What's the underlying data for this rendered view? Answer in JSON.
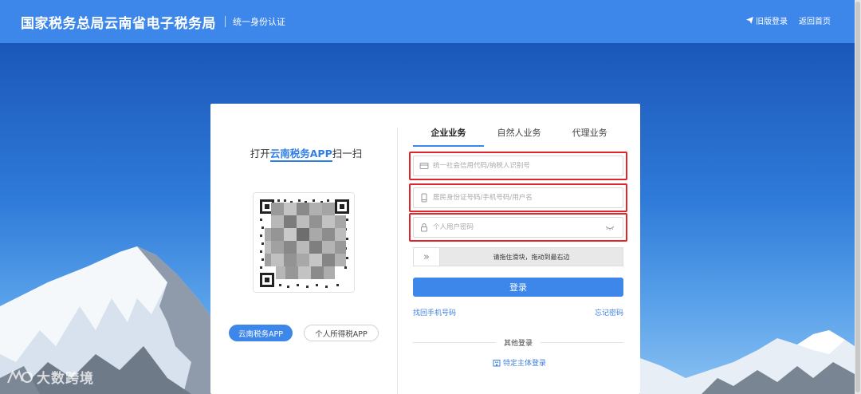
{
  "header": {
    "title": "国家税务总局云南省电子税务局",
    "subtitle": "统一身份认证",
    "old_login": "旧版登录",
    "home": "返回首页"
  },
  "left": {
    "scan_prefix": "打开",
    "scan_app": "云南税务APP",
    "scan_suffix": "扫一扫",
    "app_buttons": [
      "云南税务APP",
      "个人所得税APP"
    ]
  },
  "tabs": [
    "企业业务",
    "自然人业务",
    "代理业务"
  ],
  "active_tab": "企业业务",
  "fields": {
    "credit_code_placeholder": "统一社会信用代码/纳税人识别号",
    "id_placeholder": "居民身份证号码/手机号码/用户名",
    "password_placeholder": "个人用户密码"
  },
  "slider": {
    "handle_glyph": "»",
    "text": "请拖住滑块，拖动到最右边"
  },
  "login_button": "登录",
  "links": {
    "find_phone": "找回手机号码",
    "forgot_password": "忘记密码"
  },
  "other_login": {
    "label": "其他登录",
    "special": "特定主体登录"
  },
  "watermark": "大数跨境",
  "colors": {
    "header": "#3d86ea",
    "primary": "#3d86ea",
    "highlight_border": "#e0262a",
    "link": "#3d7fdf"
  }
}
